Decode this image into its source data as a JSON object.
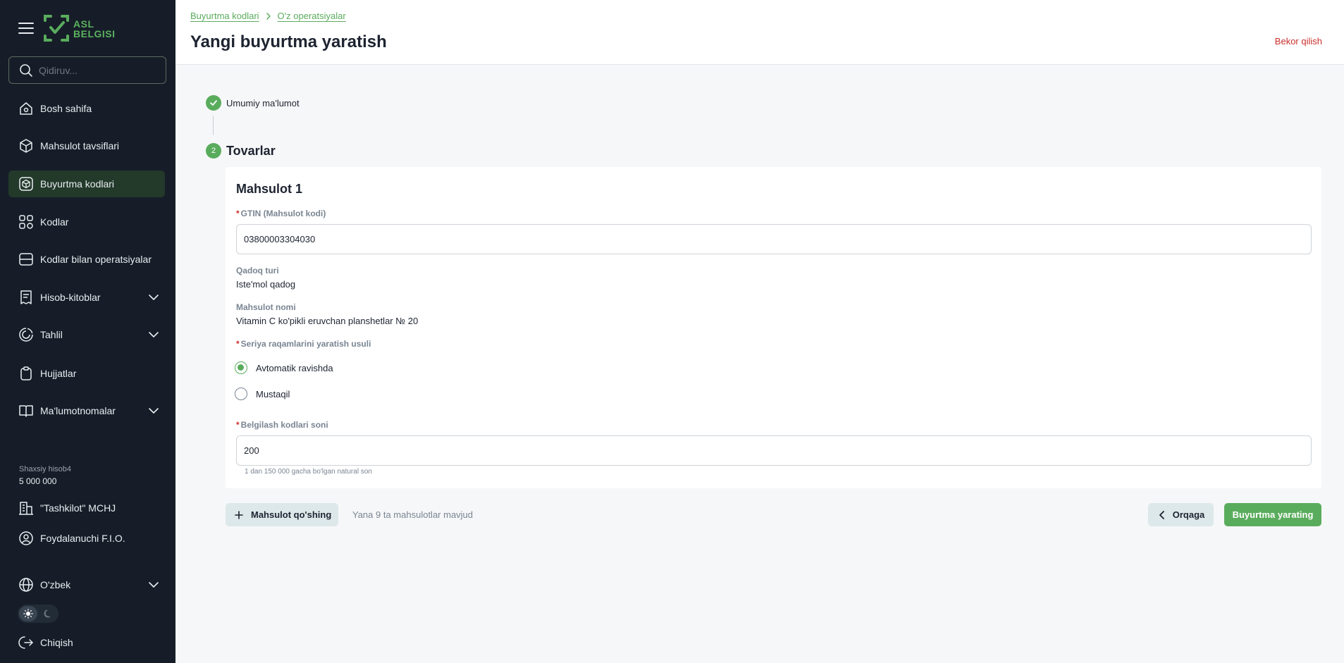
{
  "app": {
    "logo_line1": "ASL",
    "logo_line2": "BELGISI",
    "accent": "#5aac5d",
    "sidebar_bg": "#161d28"
  },
  "sidebar": {
    "search_placeholder": "Qidiruv...",
    "items": [
      {
        "label": "Bosh sahifa",
        "icon": "home-icon"
      },
      {
        "label": "Mahsulot tavsiflari",
        "icon": "cube-icon"
      },
      {
        "label": "Buyurtma kodlari",
        "icon": "order-codes-icon",
        "active": true
      },
      {
        "label": "Kodlar",
        "icon": "codes-icon"
      },
      {
        "label": "Kodlar bilan operatsiyalar",
        "icon": "operations-icon"
      },
      {
        "label": "Hisob-kitoblar",
        "icon": "receipt-icon",
        "expandable": true
      },
      {
        "label": "Tahlil",
        "icon": "analytics-icon",
        "expandable": true
      },
      {
        "label": "Hujjatlar",
        "icon": "clipboard-icon"
      },
      {
        "label": "Ma'lumotnomalar",
        "icon": "book-icon",
        "expandable": true
      }
    ],
    "account": {
      "label": "Shaxsiy hisob4",
      "value": "5 000 000"
    },
    "organization": "\"Tashkilot\" MCHJ",
    "user": "Foydalanuchi F.I.O.",
    "language": "O'zbek",
    "logout": "Chiqish"
  },
  "header": {
    "breadcrumb": [
      "Buyurtma kodlari",
      "O'z operatsiyalar"
    ],
    "title": "Yangi buyurtma yaratish",
    "cancel": "Bekor qilish"
  },
  "stepper": {
    "step1_label": "Umumiy ma'lumot",
    "step2_number": "2",
    "step2_label": "Tovarlar"
  },
  "product": {
    "title": "Mahsulot 1",
    "gtin_label": "GTIN (Mahsulot kodi)",
    "gtin_value": "03800003304030",
    "package_label": "Qadoq turi",
    "package_value": "Iste'mol qadog",
    "name_label": "Mahsulot nomi",
    "name_value": "Vitamin C ko'pikli eruvchan planshetlar № 20",
    "serial_label": "Seriya raqamlarini yaratish usuli",
    "serial_options": [
      "Avtomatik ravishda",
      "Mustaqil"
    ],
    "serial_selected": "Avtomatik ravishda",
    "count_label": "Belgilash kodlari soni",
    "count_value": "200",
    "count_hint": "1 dan 150 000 gacha bo'lgan natural son"
  },
  "actions": {
    "add_product": "Mahsulot qo'shing",
    "remaining": "Yana 9 ta mahsulotlar mavjud",
    "back": "Orqaga",
    "create": "Buyurtma yarating"
  }
}
